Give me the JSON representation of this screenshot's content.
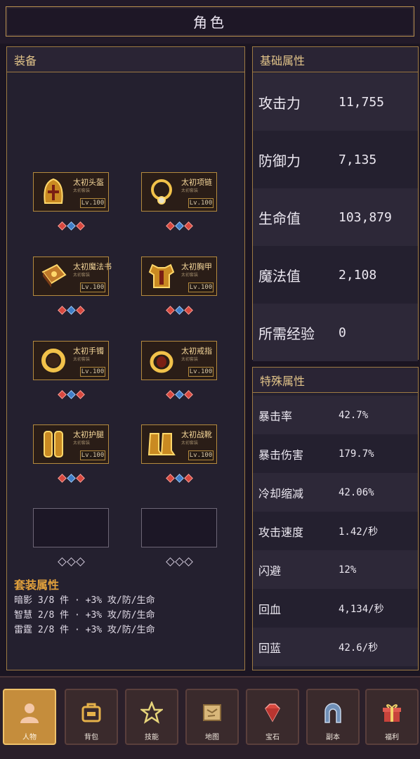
{
  "header": {
    "title": "角色"
  },
  "equipment": {
    "title": "装备",
    "slots": [
      {
        "name": "太初头盔",
        "sub": "太初套装",
        "level": "Lv.100",
        "icon": "helmet-icon",
        "gems": [
          "red",
          "blue",
          "red"
        ]
      },
      {
        "name": "太初项链",
        "sub": "太初套装",
        "level": "Lv.100",
        "icon": "necklace-icon",
        "gems": [
          "red",
          "blue",
          "red"
        ]
      },
      {
        "name": "太初魔法书",
        "sub": "太初套装",
        "level": "Lv.100",
        "icon": "spellbook-icon",
        "gems": [
          "red",
          "blue",
          "red"
        ]
      },
      {
        "name": "太初胸甲",
        "sub": "太初套装",
        "level": "Lv.100",
        "icon": "chestplate-icon",
        "gems": [
          "red",
          "blue",
          "red"
        ]
      },
      {
        "name": "太初手镯",
        "sub": "太初套装",
        "level": "Lv.100",
        "icon": "bracelet-icon",
        "gems": [
          "red",
          "blue",
          "red"
        ]
      },
      {
        "name": "太初戒指",
        "sub": "太初套装",
        "level": "Lv.100",
        "icon": "ring-icon",
        "gems": [
          "red",
          "blue",
          "red"
        ]
      },
      {
        "name": "太初护腿",
        "sub": "太初套装",
        "level": "Lv.100",
        "icon": "leggings-icon",
        "gems": [
          "red",
          "blue",
          "red"
        ]
      },
      {
        "name": "太初战靴",
        "sub": "太初套装",
        "level": "Lv.100",
        "icon": "boots-icon",
        "gems": [
          "red",
          "blue",
          "red"
        ]
      },
      {
        "name": "",
        "sub": "",
        "level": "",
        "icon": "",
        "gems": [
          "hollow",
          "hollow",
          "hollow"
        ]
      },
      {
        "name": "",
        "sub": "",
        "level": "",
        "icon": "",
        "gems": [
          "hollow",
          "hollow",
          "hollow"
        ]
      }
    ],
    "set_bonus": {
      "title": "套装属性",
      "lines": [
        "暗影 3/8 件 · +3% 攻/防/生命",
        "智慧 2/8 件 · +3% 攻/防/生命",
        "雷霆 2/8 件 · +3% 攻/防/生命"
      ]
    }
  },
  "basic_attributes": {
    "title": "基础属性",
    "rows": [
      {
        "label": "攻击力",
        "value": "11,755"
      },
      {
        "label": "防御力",
        "value": "7,135"
      },
      {
        "label": "生命值",
        "value": "103,879"
      },
      {
        "label": "魔法值",
        "value": "2,108"
      },
      {
        "label": "所需经验",
        "value": "0"
      }
    ]
  },
  "special_attributes": {
    "title": "特殊属性",
    "rows": [
      {
        "label": "暴击率",
        "value": "42.7%"
      },
      {
        "label": "暴击伤害",
        "value": "179.7%"
      },
      {
        "label": "冷却缩减",
        "value": "42.06%"
      },
      {
        "label": "攻击速度",
        "value": "1.42/秒"
      },
      {
        "label": "闪避",
        "value": "12%"
      },
      {
        "label": "回血",
        "value": "4,134/秒"
      },
      {
        "label": "回蓝",
        "value": "42.6/秒"
      }
    ]
  },
  "nav": {
    "items": [
      {
        "label": "人物",
        "icon": "character-icon",
        "active": true
      },
      {
        "label": "背包",
        "icon": "backpack-icon",
        "active": false
      },
      {
        "label": "技能",
        "icon": "skill-icon",
        "active": false
      },
      {
        "label": "地图",
        "icon": "map-icon",
        "active": false
      },
      {
        "label": "宝石",
        "icon": "gem-icon",
        "active": false
      },
      {
        "label": "副本",
        "icon": "dungeon-icon",
        "active": false
      },
      {
        "label": "福利",
        "icon": "gift-icon",
        "active": false
      }
    ]
  },
  "colors": {
    "accent_gold": "#e3c58a",
    "set_title": "#e2a13c",
    "gem_red": "#d8483e",
    "gem_blue": "#3f7ec7",
    "nav_active": "#c58d3c"
  }
}
